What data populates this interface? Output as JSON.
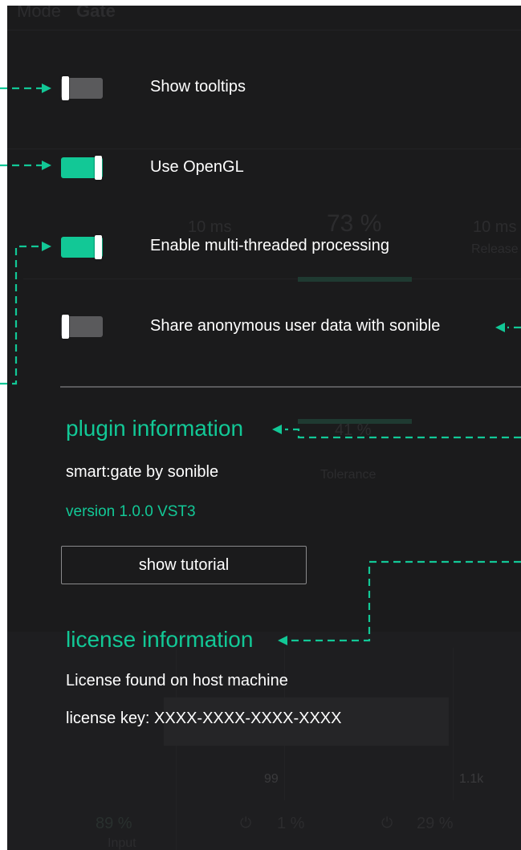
{
  "background": {
    "mode_label": "Mode",
    "mode_value": "Gate",
    "attack": "10 ms",
    "threshold": "73 %",
    "release": "10 ms",
    "release_label": "Release",
    "tolerance_value": "41 %",
    "tolerance_label": "Tolerance",
    "freq_low": "99",
    "freq_high": "1.1k",
    "input_value": "89 %",
    "input_label": "Input",
    "knob2_value": "1 %",
    "knob3_value": "29 %"
  },
  "settings": {
    "options": [
      {
        "label": "Show tooltips",
        "enabled": false
      },
      {
        "label": "Use OpenGL",
        "enabled": true
      },
      {
        "label": "Enable multi-threaded processing",
        "enabled": true
      },
      {
        "label": "Share anonymous user data with sonible",
        "enabled": false
      }
    ]
  },
  "plugin_info": {
    "heading": "plugin information",
    "product": "smart:gate by sonible",
    "version": "version 1.0.0 VST3",
    "tutorial_button": "show tutorial"
  },
  "license_info": {
    "heading": "license information",
    "status": "License found on host machine",
    "key": "license key: XXXX-XXXX-XXXX-XXXX"
  },
  "colors": {
    "accent": "#12c896",
    "panel_bg": "#1b1b1c",
    "toggle_off": "#5a5a5c",
    "text": "#ffffff"
  }
}
